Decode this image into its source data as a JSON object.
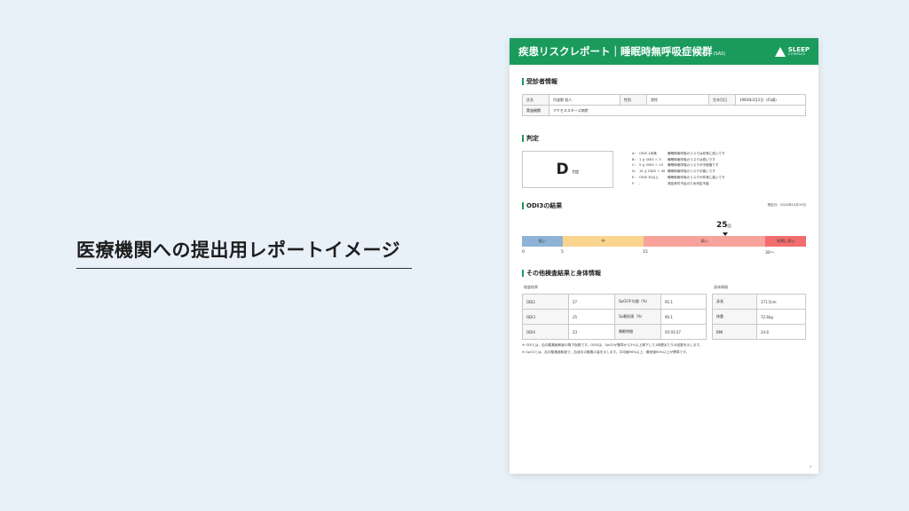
{
  "headline": "医療機関への提出用レポートイメージ",
  "report": {
    "title": "疾患リスクレポート｜睡眠時無呼吸症候群",
    "title_sub": "(SAS)",
    "logo_line1": "SLEEP",
    "logo_line2": "COMPASS",
    "page_number": "4",
    "colors": {
      "brand": "#1a9b5c",
      "low": "#8fb3d6",
      "mid": "#f9d48e",
      "high": "#f7a29b",
      "very_high": "#f26d6d"
    }
  },
  "patient": {
    "section_title": "受診者情報",
    "name_label": "氏名",
    "name_value": "丹波野 旭人",
    "sex_label": "性別",
    "sex_value": "男性",
    "dob_label": "生年月日",
    "dob_value": "1983年3月2日（41歳）",
    "facility_label": "実施機関",
    "facility_value": "アクセススターズ病院"
  },
  "judgement": {
    "section_title": "判定",
    "grade": "D",
    "grade_label": "判定",
    "scale": [
      {
        "code": "A：",
        "range": "ODI3 1未満",
        "desc": "睡眠時無呼吸のリスクは非常に低いです"
      },
      {
        "code": "B：",
        "range": "1 ≦ ODI3 ＜ 5",
        "desc": "睡眠時無呼吸のリスクは低いです"
      },
      {
        "code": "C：",
        "range": "5 ≦ ODI3 ＜ 15",
        "desc": "睡眠時無呼吸のリスクが中程度です"
      },
      {
        "code": "D：",
        "range": "15 ≦ ODI3 ＜ 30",
        "desc": "睡眠時無呼吸のリスクが高いです"
      },
      {
        "code": "E：",
        "range": "ODI3 30以上",
        "desc": "睡眠時無呼吸のリスクが非常に高いです"
      },
      {
        "code": "F：",
        "range": "-",
        "desc": "測定条件不足のため判定不能"
      }
    ]
  },
  "odi3": {
    "section_title": "ODI3の結果",
    "date": "測定日：2024年10月19日",
    "value": "25",
    "unit": "回",
    "value_num": 25,
    "scale_max": 35,
    "segments": [
      {
        "label": "低い",
        "from": 0,
        "to": 5,
        "color": "#8fb3d6"
      },
      {
        "label": "中",
        "from": 5,
        "to": 15,
        "color": "#f9d48e"
      },
      {
        "label": "高い",
        "from": 15,
        "to": 30,
        "color": "#f7a29b"
      },
      {
        "label": "非常に高い",
        "from": 30,
        "to": 35,
        "color": "#f26d6d"
      }
    ],
    "ticks": [
      "0",
      "5",
      "15",
      "30〜"
    ]
  },
  "other": {
    "section_title": "その他検査結果と身体情報",
    "exam_heading": "検査結果",
    "body_heading": "身体情報",
    "exam_rows": [
      {
        "k1": "ODI2",
        "v1": "27",
        "k2": "SpO2平均値（%）",
        "v2": "95.1"
      },
      {
        "k1": "ODI3",
        "v1": "25",
        "k2": "Sp最低値（%）",
        "v2": "90.1"
      },
      {
        "k1": "ODI4",
        "v1": "23",
        "k2": "睡眠時間",
        "v2": "05:03:27"
      }
    ],
    "body_rows": [
      {
        "k": "身長",
        "v": "171.5cm"
      },
      {
        "k": "体重",
        "v": "72.6kg"
      },
      {
        "k": "BMI",
        "v": "24.6"
      }
    ]
  },
  "notes": [
    "※ ODIとは、血中酸素飽和度の降下指数です。ODI3は、SpO2が基準から3%以上降下した1時間あたりの回数を示します。",
    "※ SpO2とは、血中酸素飽和度で、血液中の酸素の量を示します。平均値96%以上、最低値90%以上が標準です。"
  ]
}
